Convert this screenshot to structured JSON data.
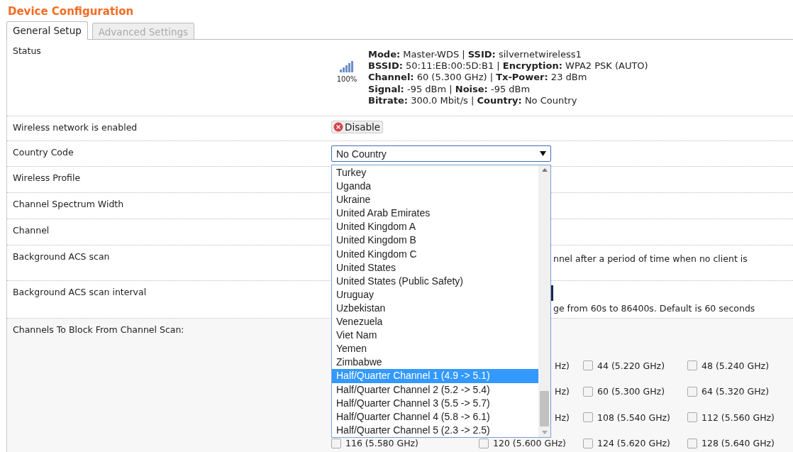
{
  "title": "Device Configuration",
  "tabs": [
    {
      "label": "General Setup",
      "selected": true,
      "disabled": false
    },
    {
      "label": "Advanced Settings",
      "selected": false,
      "disabled": true
    }
  ],
  "status": {
    "label": "Status",
    "signal_text": "100%",
    "lines": [
      "**Mode:** Master-WDS | **SSID:** silvernetwireless1",
      "**BSSID:** 50:11:EB:00:5D:B1 | **Encryption:** WPA2 PSK (AUTO)",
      "**Channel:** 60 (5.300 GHz) | **Tx-Power:** 23 dBm",
      "**Signal:** -95 dBm | **Noise:** -95 dBm",
      "**Bitrate:** 300.0 Mbit/s | **Country:** No Country"
    ]
  },
  "rows": [
    {
      "kind": "button",
      "label": "Wireless network is enabled",
      "button": "Disable"
    },
    {
      "kind": "select",
      "label": "Country Code",
      "value": "No Country"
    },
    {
      "kind": "plain",
      "label": "Wireless Profile"
    },
    {
      "kind": "plain",
      "label": "Channel Spectrum Width"
    },
    {
      "kind": "plain",
      "label": "Channel"
    },
    {
      "kind": "note",
      "label": "Background ACS scan",
      "note": "nnel after a period of time when no client is"
    },
    {
      "kind": "input",
      "label": "Background ACS scan interval",
      "note": "ge from 60s to 86400s. Default is 60 seconds"
    }
  ],
  "channels": {
    "label": "Channels To Block From Channel Scan:",
    "rows": [
      [
        {
          "kind": "empty"
        },
        {
          "kind": "fragment",
          "text": "Hz)"
        },
        {
          "kind": "checkbox",
          "label": "44 (5.220 GHz)",
          "checked": false
        },
        {
          "kind": "checkbox",
          "label": "48 (5.240 GHz)",
          "checked": false
        }
      ],
      [
        {
          "kind": "empty"
        },
        {
          "kind": "fragment",
          "text": "Hz)"
        },
        {
          "kind": "checkbox",
          "label": "60 (5.300 GHz)",
          "checked": false
        },
        {
          "kind": "checkbox",
          "label": "64 (5.320 GHz)",
          "checked": false
        }
      ],
      [
        {
          "kind": "empty"
        },
        {
          "kind": "fragment",
          "text": "Hz)"
        },
        {
          "kind": "checkbox",
          "label": "108 (5.540 GHz)",
          "checked": false
        },
        {
          "kind": "checkbox",
          "label": "112 (5.560 GHz)",
          "checked": false
        }
      ],
      [
        {
          "kind": "checkbox",
          "label": "116 (5.580 GHz)",
          "checked": false
        },
        {
          "kind": "checkbox",
          "label": "120 (5.600 GHz)",
          "checked": false
        },
        {
          "kind": "checkbox",
          "label": "124 (5.620 GHz)",
          "checked": false
        },
        {
          "kind": "checkbox",
          "label": "128 (5.640 GHz)",
          "checked": false
        }
      ]
    ]
  },
  "dropdown": {
    "options": [
      {
        "label": "Turkey",
        "selected": false
      },
      {
        "label": "Uganda",
        "selected": false
      },
      {
        "label": "Ukraine",
        "selected": false
      },
      {
        "label": "United Arab Emirates",
        "selected": false
      },
      {
        "label": "United Kingdom A",
        "selected": false
      },
      {
        "label": "United Kingdom B",
        "selected": false
      },
      {
        "label": "United Kingdom C",
        "selected": false
      },
      {
        "label": "United States",
        "selected": false
      },
      {
        "label": "United States (Public Safety)",
        "selected": false
      },
      {
        "label": "Uruguay",
        "selected": false
      },
      {
        "label": "Uzbekistan",
        "selected": false
      },
      {
        "label": "Venezuela",
        "selected": false
      },
      {
        "label": "Viet Nam",
        "selected": false
      },
      {
        "label": "Yemen",
        "selected": false
      },
      {
        "label": "Zimbabwe",
        "selected": false
      },
      {
        "label": "Half/Quarter Channel 1 (4.9 -> 5.1)",
        "selected": true
      },
      {
        "label": "Half/Quarter Channel 2 (5.2 -> 5.4)",
        "selected": false
      },
      {
        "label": "Half/Quarter Channel 3 (5.5 -> 5.7)",
        "selected": false
      },
      {
        "label": "Half/Quarter Channel 4 (5.8 -> 6.1)",
        "selected": false
      },
      {
        "label": "Half/Quarter Channel 5 (2.3 -> 2.5)",
        "selected": false
      }
    ]
  }
}
